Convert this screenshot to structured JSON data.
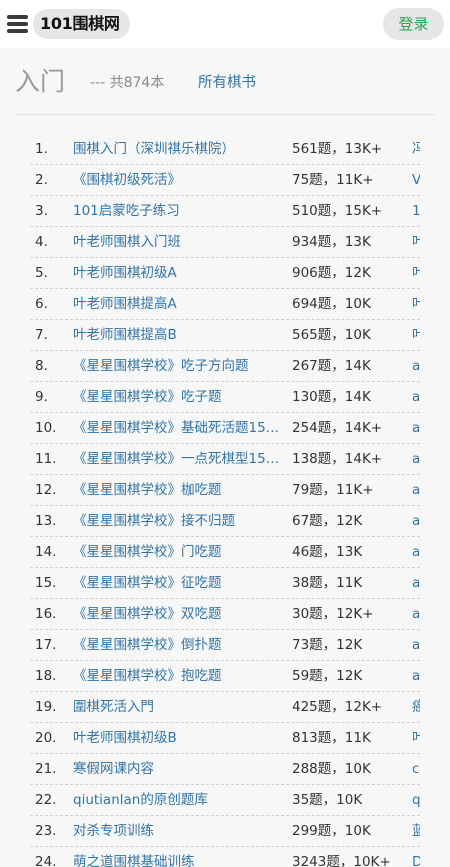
{
  "header": {
    "logo_text": "101围棋网",
    "login_label": "登录"
  },
  "page": {
    "title": "入门",
    "count_text": "--- 共874本",
    "all_books_label": "所有棋书"
  },
  "books": [
    {
      "num": "1.",
      "name": "围棋入门（深圳祺乐棋院）",
      "stats": "561题，13K+",
      "author": "冯"
    },
    {
      "num": "2.",
      "name": "《围棋初级死活》",
      "stats": "75题，11K+",
      "author": "V"
    },
    {
      "num": "3.",
      "name": "101启蒙吃子练习",
      "stats": "510题，15K+",
      "author": "1"
    },
    {
      "num": "4.",
      "name": "叶老师围棋入门班",
      "stats": "934题，13K",
      "author": "叶"
    },
    {
      "num": "5.",
      "name": "叶老师围棋初级A",
      "stats": "906题，12K",
      "author": "叶"
    },
    {
      "num": "6.",
      "name": "叶老师围棋提高A",
      "stats": "694题，10K",
      "author": "叶"
    },
    {
      "num": "7.",
      "name": "叶老师围棋提高B",
      "stats": "565题，10K",
      "author": "叶"
    },
    {
      "num": "8.",
      "name": "《星星围棋学校》吃子方向题",
      "stats": "267题，14K",
      "author": "a"
    },
    {
      "num": "9.",
      "name": "《星星围棋学校》吃子题",
      "stats": "130题，14K",
      "author": "a"
    },
    {
      "num": "10.",
      "name": "《星星围棋学校》基础死活题15…",
      "stats": "254题，14K+",
      "author": "a"
    },
    {
      "num": "11.",
      "name": "《星星围棋学校》一点死棋型15…",
      "stats": "138题，14K+",
      "author": "a"
    },
    {
      "num": "12.",
      "name": "《星星围棋学校》枷吃题",
      "stats": "79题，11K+",
      "author": "a"
    },
    {
      "num": "13.",
      "name": "《星星围棋学校》接不归题",
      "stats": "67题，12K",
      "author": "a"
    },
    {
      "num": "14.",
      "name": "《星星围棋学校》门吃题",
      "stats": "46题，13K",
      "author": "a"
    },
    {
      "num": "15.",
      "name": "《星星围棋学校》征吃题",
      "stats": "38题，11K",
      "author": "a"
    },
    {
      "num": "16.",
      "name": "《星星围棋学校》双吃题",
      "stats": "30题，12K+",
      "author": "a"
    },
    {
      "num": "17.",
      "name": "《星星围棋学校》倒扑题",
      "stats": "73题，12K",
      "author": "a"
    },
    {
      "num": "18.",
      "name": "《星星围棋学校》抱吃题",
      "stats": "59题，12K",
      "author": "a"
    },
    {
      "num": "19.",
      "name": "圍棋死活入門",
      "stats": "425题，12K+",
      "author": "癌"
    },
    {
      "num": "20.",
      "name": "叶老师围棋初级B",
      "stats": "813题，11K",
      "author": "叶"
    },
    {
      "num": "21.",
      "name": "寒假网课内容",
      "stats": "288题，10K",
      "author": "c"
    },
    {
      "num": "22.",
      "name": "qiutianlan的原创题库",
      "stats": "35题，10K",
      "author": "q"
    },
    {
      "num": "23.",
      "name": "对杀专项训练",
      "stats": "299题，10K",
      "author": "蓝"
    },
    {
      "num": "24.",
      "name": "萌之道围棋基础训练",
      "stats": "3243题，10K+",
      "author": "D"
    }
  ]
}
